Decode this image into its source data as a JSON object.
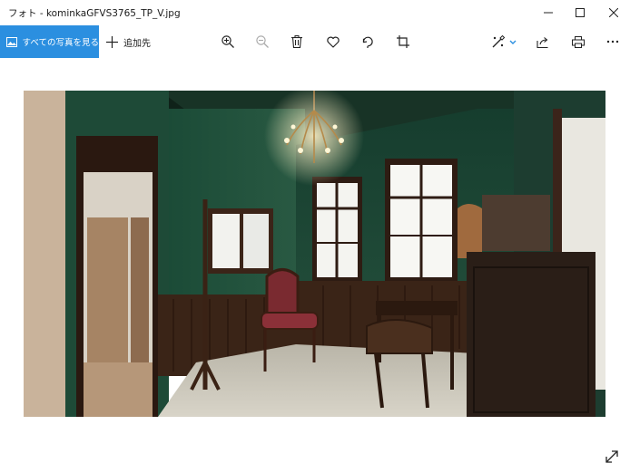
{
  "window": {
    "title": "フォト - kominkaGFVS3765_TP_V.jpg",
    "buttons": [
      "minimize",
      "maximize",
      "close"
    ]
  },
  "toolbar": {
    "all_photos_label": "すべての写真を見る",
    "add_to_label": "追加先",
    "icons": [
      "zoom-in-icon",
      "zoom-out-icon",
      "delete-icon",
      "favorite-heart-icon",
      "rotate-icon",
      "crop-icon",
      "edit-create-icon",
      "share-icon",
      "print-icon",
      "more-icon"
    ]
  },
  "photo": {
    "alt_subject": "antique room with green walls, chandelier, windows, chairs and desk"
  },
  "colors": {
    "accent": "#2b8fe0",
    "wall_green": "#1f4a38"
  }
}
